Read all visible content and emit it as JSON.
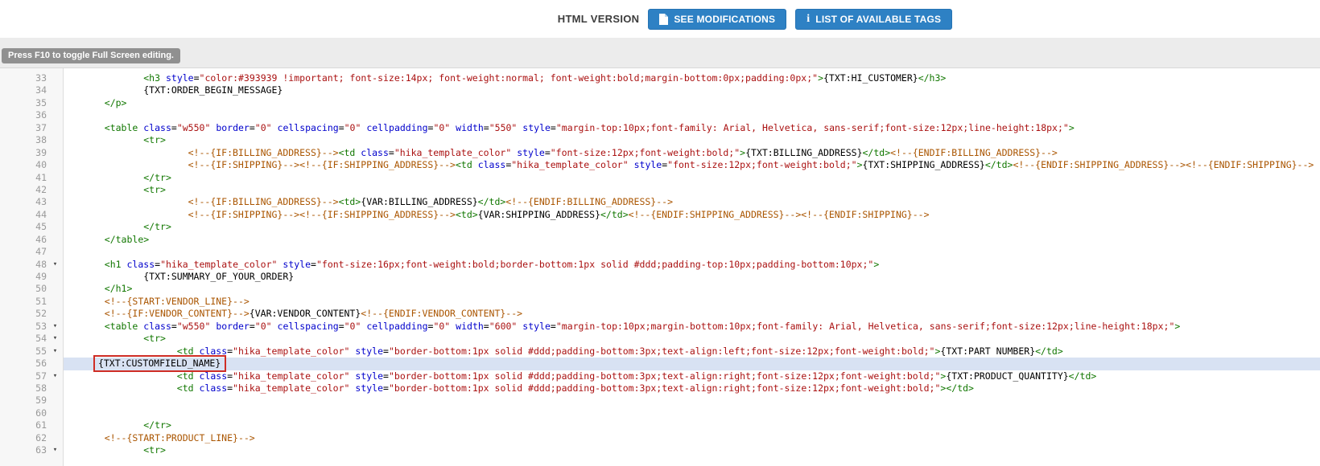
{
  "header": {
    "version_label": "HTML VERSION",
    "buttons": [
      {
        "label": "SEE MODIFICATIONS",
        "icon": "file-icon"
      },
      {
        "label": "LIST OF AVAILABLE TAGS",
        "icon": "info-icon"
      }
    ]
  },
  "tooltip": "Press F10 to toggle Full Screen editing.",
  "colors": {
    "button_blue": "#2e81c4",
    "highlight_line": "#d8e2f3",
    "red_box": "#cf2d25",
    "tag": "#117700",
    "attribute": "#0000cc",
    "string": "#aa1111",
    "comment": "#aa5500"
  },
  "editor": {
    "highlighted_line": 56,
    "boxed_token": "{TXT:CUSTOMFIELD_NAME}",
    "lines": [
      {
        "n": 33,
        "fold": false,
        "tokens": [
          [
            "p",
            "          "
          ],
          [
            "t",
            "<h3"
          ],
          [
            "p",
            " "
          ],
          [
            "a",
            "style"
          ],
          [
            "p",
            "="
          ],
          [
            "s",
            "\"color:#393939 !important; font-size:14px; font-weight:normal; font-weight:bold;margin-bottom:0px;padding:0px;\""
          ],
          [
            "t",
            ">"
          ],
          [
            "p",
            "{TXT:HI_CUSTOMER}"
          ],
          [
            "t",
            "</h3>"
          ]
        ]
      },
      {
        "n": 34,
        "fold": false,
        "tokens": [
          [
            "p",
            "          {TXT:ORDER_BEGIN_MESSAGE}"
          ]
        ]
      },
      {
        "n": 35,
        "fold": false,
        "tokens": [
          [
            "p",
            "   "
          ],
          [
            "t",
            "</p>"
          ]
        ]
      },
      {
        "n": 36,
        "fold": false,
        "tokens": []
      },
      {
        "n": 37,
        "fold": false,
        "tokens": [
          [
            "p",
            "   "
          ],
          [
            "t",
            "<table"
          ],
          [
            "p",
            " "
          ],
          [
            "a",
            "class"
          ],
          [
            "p",
            "="
          ],
          [
            "s",
            "\"w550\""
          ],
          [
            "p",
            " "
          ],
          [
            "a",
            "border"
          ],
          [
            "p",
            "="
          ],
          [
            "s",
            "\"0\""
          ],
          [
            "p",
            " "
          ],
          [
            "a",
            "cellspacing"
          ],
          [
            "p",
            "="
          ],
          [
            "s",
            "\"0\""
          ],
          [
            "p",
            " "
          ],
          [
            "a",
            "cellpadding"
          ],
          [
            "p",
            "="
          ],
          [
            "s",
            "\"0\""
          ],
          [
            "p",
            " "
          ],
          [
            "a",
            "width"
          ],
          [
            "p",
            "="
          ],
          [
            "s",
            "\"550\""
          ],
          [
            "p",
            " "
          ],
          [
            "a",
            "style"
          ],
          [
            "p",
            "="
          ],
          [
            "s",
            "\"margin-top:10px;font-family: Arial, Helvetica, sans-serif;font-size:12px;line-height:18px;\""
          ],
          [
            "t",
            ">"
          ]
        ]
      },
      {
        "n": 38,
        "fold": false,
        "tokens": [
          [
            "p",
            "          "
          ],
          [
            "t",
            "<tr>"
          ]
        ]
      },
      {
        "n": 39,
        "fold": false,
        "tokens": [
          [
            "p",
            "                  "
          ],
          [
            "c",
            "<!--{IF:BILLING_ADDRESS}-->"
          ],
          [
            "t",
            "<td"
          ],
          [
            "p",
            " "
          ],
          [
            "a",
            "class"
          ],
          [
            "p",
            "="
          ],
          [
            "s",
            "\"hika_template_color\""
          ],
          [
            "p",
            " "
          ],
          [
            "a",
            "style"
          ],
          [
            "p",
            "="
          ],
          [
            "s",
            "\"font-size:12px;font-weight:bold;\""
          ],
          [
            "t",
            ">"
          ],
          [
            "p",
            "{TXT:BILLING_ADDRESS}"
          ],
          [
            "t",
            "</td>"
          ],
          [
            "c",
            "<!--{ENDIF:BILLING_ADDRESS}-->"
          ]
        ]
      },
      {
        "n": 40,
        "fold": false,
        "tokens": [
          [
            "p",
            "                  "
          ],
          [
            "c",
            "<!--{IF:SHIPPING}--><!--{IF:SHIPPING_ADDRESS}-->"
          ],
          [
            "t",
            "<td"
          ],
          [
            "p",
            " "
          ],
          [
            "a",
            "class"
          ],
          [
            "p",
            "="
          ],
          [
            "s",
            "\"hika_template_color\""
          ],
          [
            "p",
            " "
          ],
          [
            "a",
            "style"
          ],
          [
            "p",
            "="
          ],
          [
            "s",
            "\"font-size:12px;font-weight:bold;\""
          ],
          [
            "t",
            ">"
          ],
          [
            "p",
            "{TXT:SHIPPING_ADDRESS}"
          ],
          [
            "t",
            "</td>"
          ],
          [
            "c",
            "<!--{ENDIF:SHIPPING_ADDRESS}--><!--{ENDIF:SHIPPING}-->"
          ]
        ]
      },
      {
        "n": 41,
        "fold": false,
        "tokens": [
          [
            "p",
            "          "
          ],
          [
            "t",
            "</tr>"
          ]
        ]
      },
      {
        "n": 42,
        "fold": false,
        "tokens": [
          [
            "p",
            "          "
          ],
          [
            "t",
            "<tr>"
          ]
        ]
      },
      {
        "n": 43,
        "fold": false,
        "tokens": [
          [
            "p",
            "                  "
          ],
          [
            "c",
            "<!--{IF:BILLING_ADDRESS}-->"
          ],
          [
            "t",
            "<td>"
          ],
          [
            "p",
            "{VAR:BILLING_ADDRESS}"
          ],
          [
            "t",
            "</td>"
          ],
          [
            "c",
            "<!--{ENDIF:BILLING_ADDRESS}-->"
          ]
        ]
      },
      {
        "n": 44,
        "fold": false,
        "tokens": [
          [
            "p",
            "                  "
          ],
          [
            "c",
            "<!--{IF:SHIPPING}--><!--{IF:SHIPPING_ADDRESS}-->"
          ],
          [
            "t",
            "<td>"
          ],
          [
            "p",
            "{VAR:SHIPPING_ADDRESS}"
          ],
          [
            "t",
            "</td>"
          ],
          [
            "c",
            "<!--{ENDIF:SHIPPING_ADDRESS}--><!--{ENDIF:SHIPPING}-->"
          ]
        ]
      },
      {
        "n": 45,
        "fold": false,
        "tokens": [
          [
            "p",
            "          "
          ],
          [
            "t",
            "</tr>"
          ]
        ]
      },
      {
        "n": 46,
        "fold": false,
        "tokens": [
          [
            "p",
            "   "
          ],
          [
            "t",
            "</table>"
          ]
        ]
      },
      {
        "n": 47,
        "fold": false,
        "tokens": []
      },
      {
        "n": 48,
        "fold": true,
        "tokens": [
          [
            "p",
            "   "
          ],
          [
            "t",
            "<h1"
          ],
          [
            "p",
            " "
          ],
          [
            "a",
            "class"
          ],
          [
            "p",
            "="
          ],
          [
            "s",
            "\"hika_template_color\""
          ],
          [
            "p",
            " "
          ],
          [
            "a",
            "style"
          ],
          [
            "p",
            "="
          ],
          [
            "s",
            "\"font-size:16px;font-weight:bold;border-bottom:1px solid #ddd;padding-top:10px;padding-bottom:10px;\""
          ],
          [
            "t",
            ">"
          ]
        ]
      },
      {
        "n": 49,
        "fold": false,
        "tokens": [
          [
            "p",
            "          {TXT:SUMMARY_OF_YOUR_ORDER}"
          ]
        ]
      },
      {
        "n": 50,
        "fold": false,
        "tokens": [
          [
            "p",
            "   "
          ],
          [
            "t",
            "</h1>"
          ]
        ]
      },
      {
        "n": 51,
        "fold": false,
        "tokens": [
          [
            "p",
            "   "
          ],
          [
            "c",
            "<!--{START:VENDOR_LINE}-->"
          ]
        ]
      },
      {
        "n": 52,
        "fold": false,
        "tokens": [
          [
            "p",
            "   "
          ],
          [
            "c",
            "<!--{IF:VENDOR_CONTENT}-->"
          ],
          [
            "p",
            "{VAR:VENDOR_CONTENT}"
          ],
          [
            "c",
            "<!--{ENDIF:VENDOR_CONTENT}-->"
          ]
        ]
      },
      {
        "n": 53,
        "fold": true,
        "tokens": [
          [
            "p",
            "   "
          ],
          [
            "t",
            "<table"
          ],
          [
            "p",
            " "
          ],
          [
            "a",
            "class"
          ],
          [
            "p",
            "="
          ],
          [
            "s",
            "\"w550\""
          ],
          [
            "p",
            " "
          ],
          [
            "a",
            "border"
          ],
          [
            "p",
            "="
          ],
          [
            "s",
            "\"0\""
          ],
          [
            "p",
            " "
          ],
          [
            "a",
            "cellspacing"
          ],
          [
            "p",
            "="
          ],
          [
            "s",
            "\"0\""
          ],
          [
            "p",
            " "
          ],
          [
            "a",
            "cellpadding"
          ],
          [
            "p",
            "="
          ],
          [
            "s",
            "\"0\""
          ],
          [
            "p",
            " "
          ],
          [
            "a",
            "width"
          ],
          [
            "p",
            "="
          ],
          [
            "s",
            "\"600\""
          ],
          [
            "p",
            " "
          ],
          [
            "a",
            "style"
          ],
          [
            "p",
            "="
          ],
          [
            "s",
            "\"margin-top:10px;margin-bottom:10px;font-family: Arial, Helvetica, sans-serif;font-size:12px;line-height:18px;\""
          ],
          [
            "t",
            ">"
          ]
        ]
      },
      {
        "n": 54,
        "fold": true,
        "tokens": [
          [
            "p",
            "          "
          ],
          [
            "t",
            "<tr>"
          ]
        ]
      },
      {
        "n": 55,
        "fold": true,
        "tokens": [
          [
            "p",
            "                "
          ],
          [
            "t",
            "<td"
          ],
          [
            "p",
            " "
          ],
          [
            "a",
            "class"
          ],
          [
            "p",
            "="
          ],
          [
            "s",
            "\"hika_template_color\""
          ],
          [
            "p",
            " "
          ],
          [
            "a",
            "style"
          ],
          [
            "p",
            "="
          ],
          [
            "s",
            "\"border-bottom:1px solid #ddd;padding-bottom:3px;text-align:left;font-size:12px;font-weight:bold;\""
          ],
          [
            "t",
            ">"
          ],
          [
            "p",
            "{TXT:PART NUMBER}"
          ],
          [
            "t",
            "</td>"
          ]
        ]
      },
      {
        "n": 56,
        "fold": false,
        "tokens": [
          [
            "p",
            " "
          ],
          [
            "x",
            "{TXT:CUSTOMFIELD_NAME}"
          ]
        ]
      },
      {
        "n": 57,
        "fold": true,
        "tokens": [
          [
            "p",
            "                "
          ],
          [
            "t",
            "<td"
          ],
          [
            "p",
            " "
          ],
          [
            "a",
            "class"
          ],
          [
            "p",
            "="
          ],
          [
            "s",
            "\"hika_template_color\""
          ],
          [
            "p",
            " "
          ],
          [
            "a",
            "style"
          ],
          [
            "p",
            "="
          ],
          [
            "s",
            "\"border-bottom:1px solid #ddd;padding-bottom:3px;text-align:right;font-size:12px;font-weight:bold;\""
          ],
          [
            "t",
            ">"
          ],
          [
            "p",
            "{TXT:PRODUCT_QUANTITY}"
          ],
          [
            "t",
            "</td>"
          ]
        ]
      },
      {
        "n": 58,
        "fold": false,
        "tokens": [
          [
            "p",
            "                "
          ],
          [
            "t",
            "<td"
          ],
          [
            "p",
            " "
          ],
          [
            "a",
            "class"
          ],
          [
            "p",
            "="
          ],
          [
            "s",
            "\"hika_template_color\""
          ],
          [
            "p",
            " "
          ],
          [
            "a",
            "style"
          ],
          [
            "p",
            "="
          ],
          [
            "s",
            "\"border-bottom:1px solid #ddd;padding-bottom:3px;text-align:right;font-size:12px;font-weight:bold;\""
          ],
          [
            "t",
            ">"
          ],
          [
            "t",
            "</td>"
          ]
        ]
      },
      {
        "n": 59,
        "fold": false,
        "tokens": []
      },
      {
        "n": 60,
        "fold": false,
        "tokens": []
      },
      {
        "n": 61,
        "fold": false,
        "tokens": [
          [
            "p",
            "          "
          ],
          [
            "t",
            "</tr>"
          ]
        ]
      },
      {
        "n": 62,
        "fold": false,
        "tokens": [
          [
            "p",
            "   "
          ],
          [
            "c",
            "<!--{START:PRODUCT_LINE}-->"
          ]
        ]
      },
      {
        "n": 63,
        "fold": true,
        "tokens": [
          [
            "p",
            "          "
          ],
          [
            "t",
            "<tr>"
          ]
        ]
      }
    ]
  }
}
